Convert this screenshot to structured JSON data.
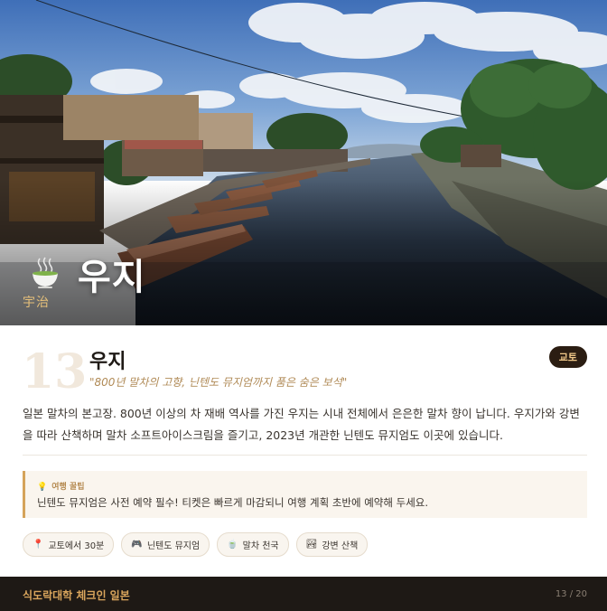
{
  "hero": {
    "title": "우지",
    "kanji": "宇治",
    "icon": "matcha-tea-cup-icon"
  },
  "card": {
    "number": "13",
    "title": "우지",
    "subtitle": "\"800년 말차의 고향, 닌텐도 뮤지엄까지 품은 숨은 보석\"",
    "region": "교토",
    "description": "일본 말차의 본고장. 800년 이상의 차 재배 역사를 가진 우지는 시내 전체에서 은은한 말차 향이 납니다. 우지가와 강변을 따라 산책하며 말차 소프트아이스크림을 즐기고, 2023년 개관한 닌텐도 뮤지엄도 이곳에 있습니다.",
    "tip": {
      "label": "여행 꿀팁",
      "text": "닌텐도 뮤지엄은 사전 예약 필수! 티켓은 빠르게 마감되니 여행 계획 초반에 예약해 두세요."
    },
    "tags": [
      {
        "icon": "pin-icon",
        "glyph": "📍",
        "label": "교토에서 30분"
      },
      {
        "icon": "gamepad-icon",
        "glyph": "🎮",
        "label": "닌텐도 뮤지엄"
      },
      {
        "icon": "tea-icon",
        "glyph": "🍵",
        "label": "말차 천국"
      },
      {
        "icon": "river-icon",
        "glyph": "🏞",
        "label": "강변 산책"
      }
    ]
  },
  "footer": {
    "brand": "식도락대학 체크인 일본",
    "page": "13 / 20"
  },
  "colors": {
    "accent": "#d9a55c",
    "badge_bg": "#2b1d12",
    "footer_bg": "#1e1915"
  }
}
